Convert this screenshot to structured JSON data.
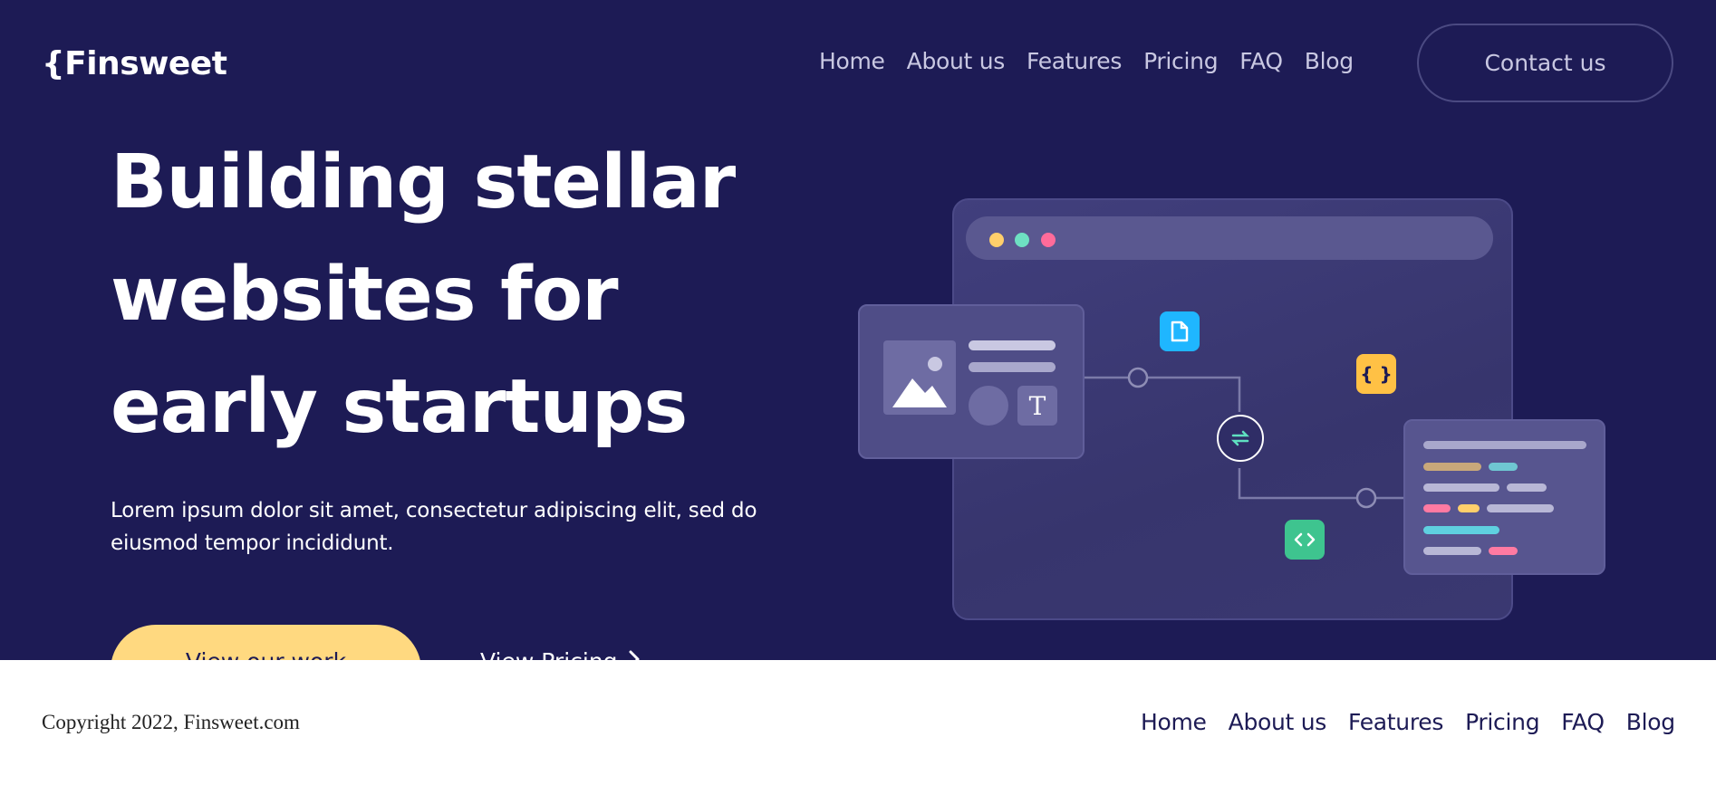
{
  "header": {
    "logo": "{Finsweet",
    "nav": [
      "Home",
      "About us",
      "Features",
      "Pricing",
      "FAQ",
      "Blog"
    ],
    "contact_label": "Contact us"
  },
  "hero": {
    "headline": "Building stellar websites for early startups",
    "subtext": "Lorem ipsum dolor sit amet, consectetur adipiscing elit, sed do eiusmod tempor incididunt.",
    "primary_button": "View our work",
    "secondary_link": "View Pricing",
    "secondary_icon": "arrow-right-icon"
  },
  "illustration": {
    "window_dots": [
      "#ffcf6b",
      "#6ee0c2",
      "#ff6b9a"
    ],
    "icons": [
      "image-icon",
      "text-icon",
      "document-icon",
      "braces-icon",
      "sync-icon",
      "code-icon"
    ],
    "colors": {
      "document": "#1fb6ff",
      "braces": "#ffc145",
      "code": "#3ec48f"
    }
  },
  "footer": {
    "copyright": "Copyright 2022, Finsweet.com",
    "nav": [
      "Home",
      "About us",
      "Features",
      "Pricing",
      "FAQ",
      "Blog"
    ]
  },
  "colors": {
    "background": "#1d1b55",
    "accent": "#ffd980",
    "text_light": "#ffffff",
    "nav_text": "#c9c8e2"
  }
}
